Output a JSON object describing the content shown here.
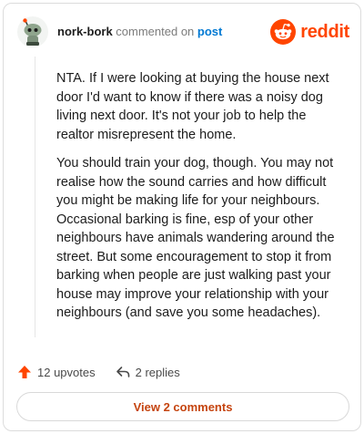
{
  "comment": {
    "username": "nork-bork",
    "action_text": "commented on",
    "post_link": "post",
    "avatar_icon": "snoo-avatar-icon",
    "paragraphs": [
      "NTA. If I were looking at buying the house next door I'd want to know if there was a noisy dog living next door. It's not your job to help the realtor misrepresent the home.",
      "You should train your dog, though. You may not realise how the sound carries and how difficult you might be making life for your neighbours. Occasional barking is fine, esp of your other neighbours have animals wandering around the street. But some encouragement to stop it from barking when people are just walking past your house may improve your relationship with your neighbours (and save you some headaches)."
    ]
  },
  "brand": {
    "name": "reddit",
    "icon": "reddit-logo-icon",
    "color": "#ff4500"
  },
  "actions": {
    "upvotes": "12 upvotes",
    "upvote_icon": "upvote-arrow-icon",
    "replies": "2 replies",
    "reply_icon": "reply-arrow-icon"
  },
  "view_button": {
    "label": "View 2 comments"
  },
  "colors": {
    "accent": "#ff4500",
    "link": "#0079d3",
    "button_text": "#c5440f"
  }
}
